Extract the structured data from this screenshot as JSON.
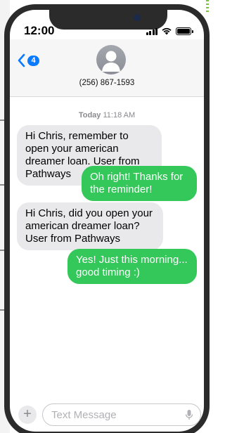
{
  "status_bar": {
    "time": "12:00"
  },
  "header": {
    "back_badge": "4",
    "contact_number": "(256) 867-1593"
  },
  "thread": {
    "timestamp_day": "Today",
    "timestamp_time": "11:18 AM",
    "messages": [
      {
        "direction": "incoming",
        "text": "Hi Chris, remember to open your american dreamer loan. User from Pathways"
      },
      {
        "direction": "outgoing",
        "text": "Oh right! Thanks for the reminder!"
      },
      {
        "direction": "incoming",
        "text": "Hi Chris, did you open your american dreamer loan? User from Pathways"
      },
      {
        "direction": "outgoing",
        "text": "Yes! Just this morning... good timing :)"
      }
    ]
  },
  "composer": {
    "plus_label": "+",
    "placeholder": "Text Message"
  },
  "colors": {
    "outgoing": "#34c759",
    "incoming": "#e9e9eb",
    "accent": "#0a7aff"
  },
  "icons": [
    "back-chevron-icon",
    "avatar-icon",
    "signal-icon",
    "wifi-icon",
    "battery-icon",
    "microphone-icon"
  ]
}
